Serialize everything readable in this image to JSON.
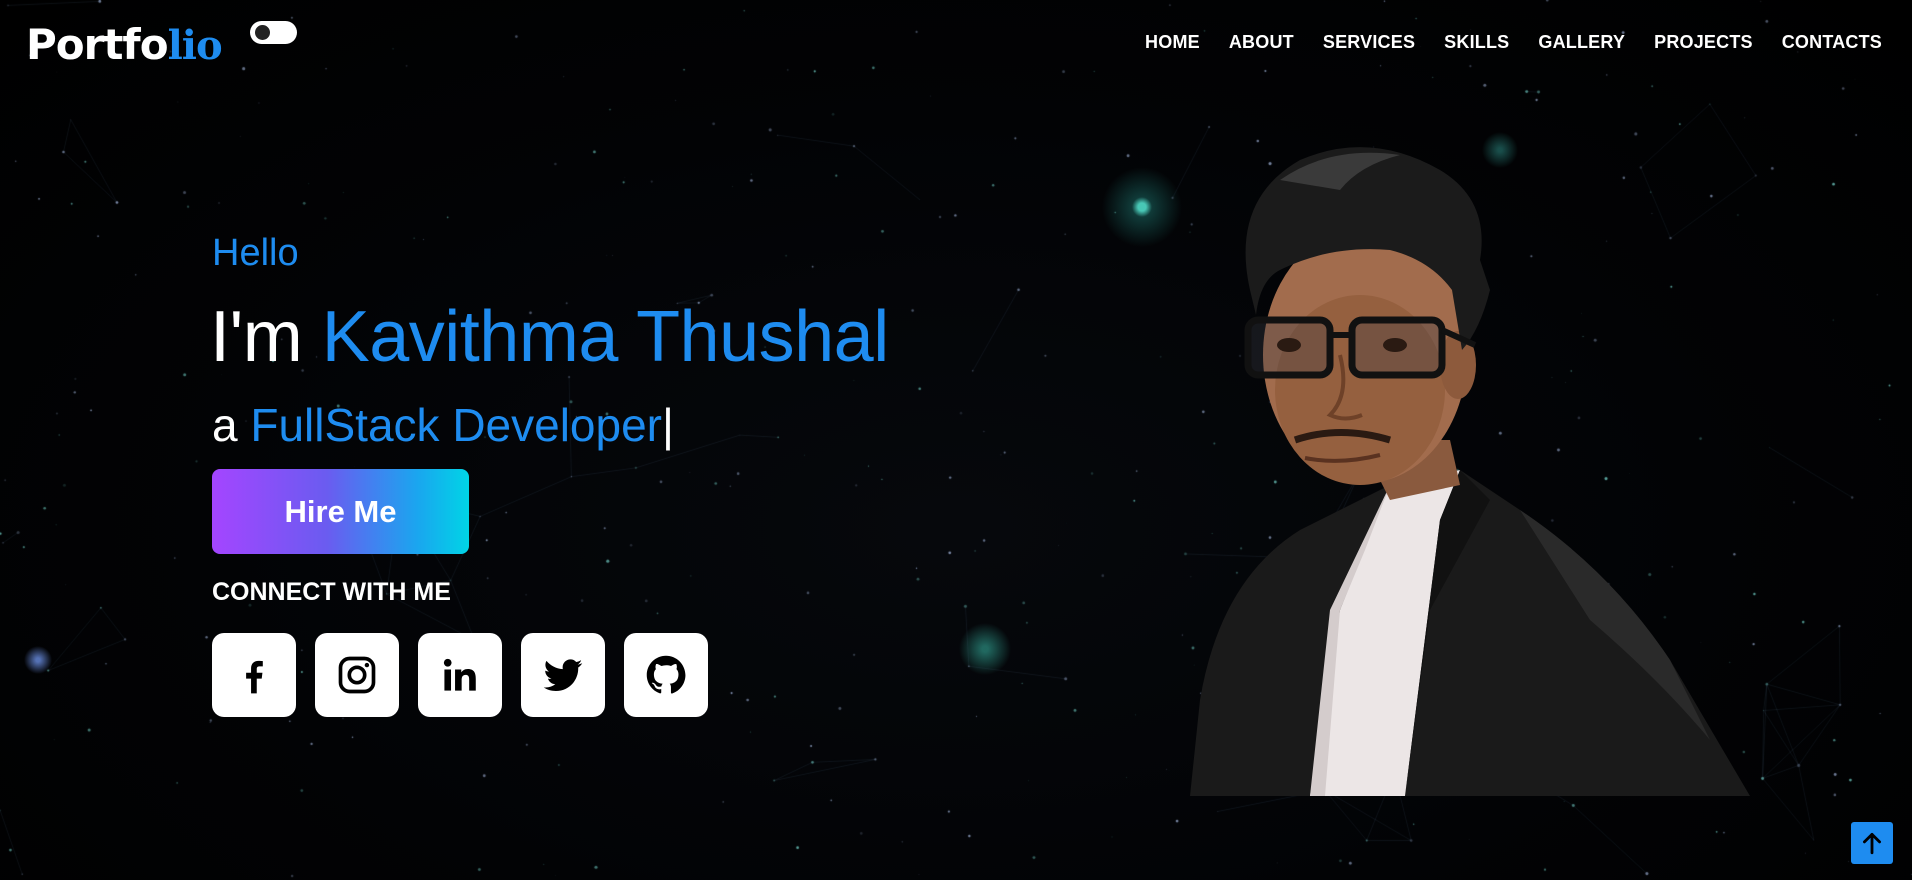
{
  "header": {
    "logo_main": "Portfo",
    "logo_accent": "lio",
    "theme_toggle": "dark-mode-toggle",
    "nav": [
      "HOME",
      "ABOUT",
      "SERVICES",
      "SKILLS",
      "GALLERY",
      "PROJECTS",
      "CONTACTS"
    ]
  },
  "hero": {
    "greeting": "Hello",
    "name_prefix": "I'm ",
    "name": "Kavithma Thushal",
    "role_prefix": "a ",
    "role": "FullStack Developer",
    "role_cursor": "|",
    "cta_label": "Hire Me",
    "connect_label": "CONNECT WITH ME"
  },
  "socials": [
    {
      "icon": "facebook-icon"
    },
    {
      "icon": "instagram-icon"
    },
    {
      "icon": "linkedin-icon"
    },
    {
      "icon": "twitter-icon"
    },
    {
      "icon": "github-icon"
    }
  ],
  "scroll_top_icon": "arrow-up-icon",
  "colors": {
    "accent": "#1e8cf0",
    "background": "#000000",
    "cta_gradient_start": "#a445ff",
    "cta_gradient_end": "#00d4e6"
  }
}
